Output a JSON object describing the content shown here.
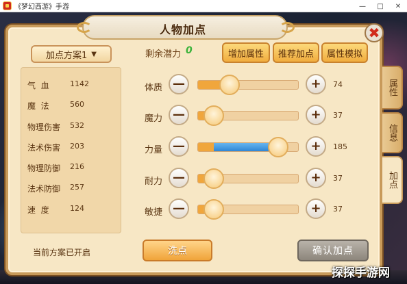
{
  "window": {
    "title": "《梦幻西游》手游"
  },
  "panel": {
    "title": "人物加点"
  },
  "left": {
    "scheme_label": "加点方案1",
    "stats": [
      {
        "name": "气  血",
        "value": "1142"
      },
      {
        "name": "魔  法",
        "value": "560"
      },
      {
        "name": "物理伤害",
        "value": "532"
      },
      {
        "name": "法术伤害",
        "value": "203"
      },
      {
        "name": "物理防御",
        "value": "216"
      },
      {
        "name": "法术防御",
        "value": "257"
      },
      {
        "name": "速  度",
        "value": "124"
      }
    ],
    "status": "当前方案已开启"
  },
  "right": {
    "remain_label": "剩余潜力",
    "remain_value": "0",
    "buttons": {
      "add": "增加属性",
      "recommend": "推荐加点",
      "simulate": "属性模拟"
    },
    "attributes": [
      {
        "name": "体质",
        "value": "74",
        "fill": 0.32,
        "boost": 0.0
      },
      {
        "name": "魔力",
        "value": "37",
        "fill": 0.16,
        "boost": 0.0
      },
      {
        "name": "力量",
        "value": "185",
        "fill": 0.16,
        "boost": 0.64
      },
      {
        "name": "耐力",
        "value": "37",
        "fill": 0.16,
        "boost": 0.0
      },
      {
        "name": "敏捷",
        "value": "37",
        "fill": 0.16,
        "boost": 0.0
      }
    ],
    "reset": "洗点",
    "confirm": "确认加点"
  },
  "tabs": [
    {
      "label": "属性",
      "active": false
    },
    {
      "label": "信息",
      "active": false
    },
    {
      "label": "加点",
      "active": true
    }
  ],
  "watermark": "探探手游网",
  "colors": {
    "accent": "#f0a63c",
    "boost": "#2f86d6",
    "remain": "#3cb33c",
    "close": "#d12b1c"
  }
}
